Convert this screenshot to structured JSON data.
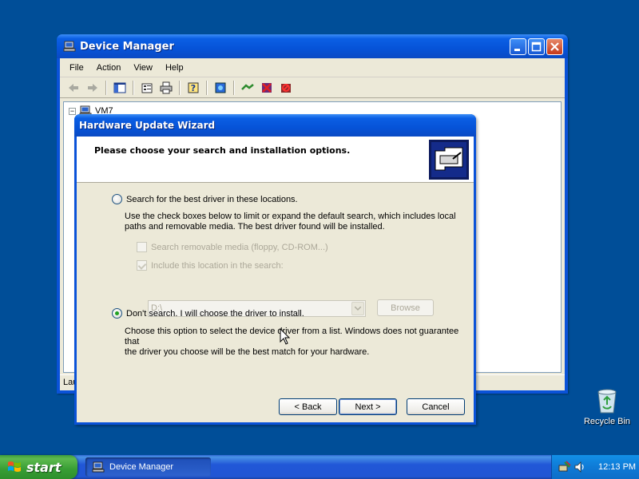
{
  "device_manager": {
    "title": "Device Manager",
    "menu": [
      "File",
      "Action",
      "View",
      "Help"
    ],
    "toolbar_icons": [
      "back-arrow-icon",
      "forward-arrow-icon",
      "console-tree-icon",
      "properties-icon",
      "print-icon",
      "help-icon",
      "scan-hardware-icon",
      "update-driver-icon",
      "disable-device-icon",
      "uninstall-device-icon"
    ],
    "tree_root": "VM7",
    "status_text": "Lau"
  },
  "wizard": {
    "title": "Hardware Update Wizard",
    "heading": "Please choose your search and installation options.",
    "option_search": {
      "label": "Search for the best driver in these locations.",
      "checked": false,
      "description_line1": "Use the check boxes below to limit or expand the default search, which includes local",
      "description_line2": "paths and removable media. The best driver found will be installed."
    },
    "check_removable": {
      "label": "Search removable media (floppy, CD-ROM...)",
      "checked": false,
      "enabled": false
    },
    "check_location": {
      "label": "Include this location in the search:",
      "checked": true,
      "enabled": false
    },
    "location_value": "D:\\",
    "browse_label": "Browse",
    "option_dont_search": {
      "label": "Don't search. I will choose the driver to install.",
      "checked": true,
      "description_line1": "Choose this option to select the device driver from a list.  Windows does not guarantee that",
      "description_line2": "the driver you choose will be the best match for your hardware."
    },
    "back_label": "< Back",
    "next_label": "Next >",
    "cancel_label": "Cancel"
  },
  "desktop": {
    "recycle_bin_label": "Recycle Bin",
    "background_color": "#004e98"
  },
  "taskbar": {
    "start_label": "start",
    "task_item_label": "Device Manager",
    "clock": "12:13 PM"
  }
}
